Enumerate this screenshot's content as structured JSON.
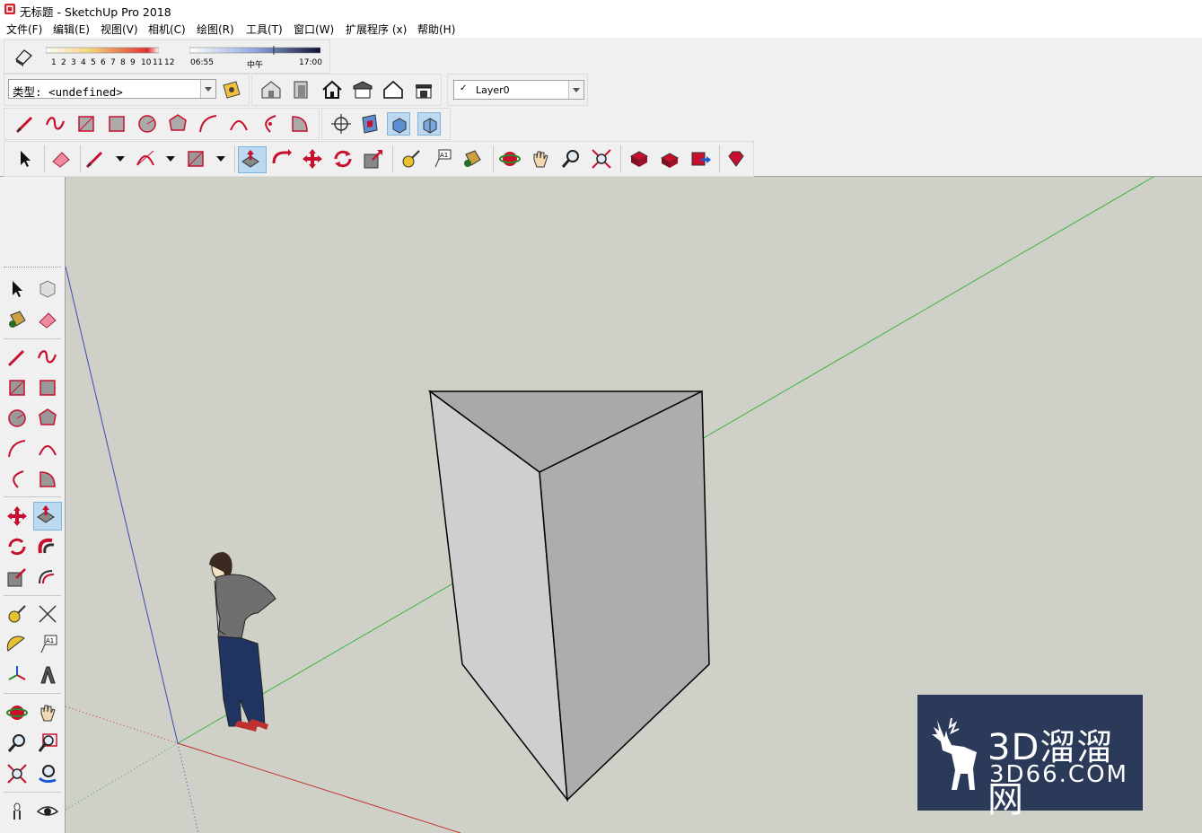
{
  "window": {
    "title": "无标题 - SketchUp Pro 2018"
  },
  "menu": [
    "文件(F)",
    "编辑(E)",
    "视图(V)",
    "相机(C)",
    "绘图(R)",
    "工具(T)",
    "窗口(W)",
    "扩展程序 (x)",
    "帮助(H)"
  ],
  "shadows": {
    "months": [
      "1",
      "2",
      "3",
      "4",
      "5",
      "6",
      "7",
      "8",
      "9",
      "10",
      "11",
      "12"
    ],
    "time_start": "06:55",
    "time_mid": "中午",
    "time_end": "17:00"
  },
  "type_selector": {
    "value": "类型: <undefined>"
  },
  "layer": {
    "check": "✓",
    "value": "Layer0"
  },
  "watermark": {
    "cn": "3D溜溜网",
    "en": "3D66.COM"
  },
  "icons": {
    "accent": "#c8102e",
    "selection_highlight": "#bcd9f2"
  }
}
